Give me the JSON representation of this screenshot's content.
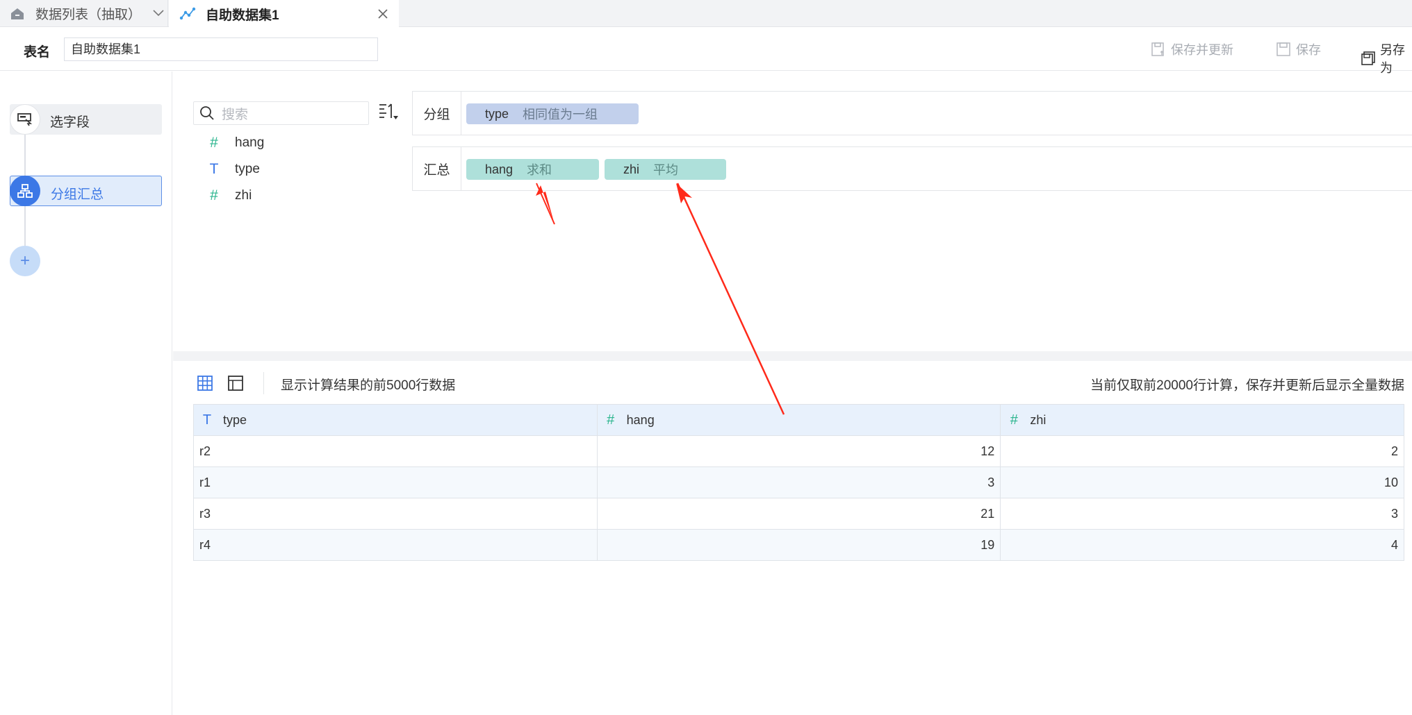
{
  "tabs": [
    {
      "label": "数据列表（抽取）",
      "icon": "home-icon"
    },
    {
      "label": "自助数据集1",
      "icon": "dataset-icon"
    }
  ],
  "header": {
    "name_label": "表名",
    "name_value": "自助数据集1",
    "save_update_label": "保存并更新",
    "save_label": "保存",
    "save_as_label": "另存为"
  },
  "steps": [
    {
      "label": "选字段",
      "icon": "select-field-icon"
    },
    {
      "label": "分组汇总",
      "icon": "group-summary-icon"
    }
  ],
  "add_step_symbol": "+",
  "fields": {
    "search_placeholder": "搜索",
    "items": [
      {
        "type_symbol": "#",
        "name": "hang"
      },
      {
        "type_symbol": "T",
        "name": "type"
      },
      {
        "type_symbol": "#",
        "name": "zhi"
      }
    ]
  },
  "group": {
    "label": "分组",
    "chips": [
      {
        "name": "type",
        "agg": "相同值为一组"
      }
    ]
  },
  "summary": {
    "label": "汇总",
    "chips": [
      {
        "name": "hang",
        "agg": "求和"
      },
      {
        "name": "zhi",
        "agg": "平均"
      }
    ]
  },
  "preview": {
    "info": "显示计算结果的前5000行数据",
    "note": "当前仅取前20000行计算，保存并更新后显示全量数据",
    "columns": [
      {
        "type_symbol": "T",
        "name": "type"
      },
      {
        "type_symbol": "#",
        "name": "hang"
      },
      {
        "type_symbol": "#",
        "name": "zhi"
      }
    ],
    "rows": [
      [
        "r2",
        "12",
        "2"
      ],
      [
        "r1",
        "3",
        "10"
      ],
      [
        "r3",
        "21",
        "3"
      ],
      [
        "r4",
        "19",
        "4"
      ]
    ]
  },
  "colors": {
    "accent": "#3c78e6",
    "number_type": "#2bb58e",
    "arrow": "#ff2a1a"
  }
}
